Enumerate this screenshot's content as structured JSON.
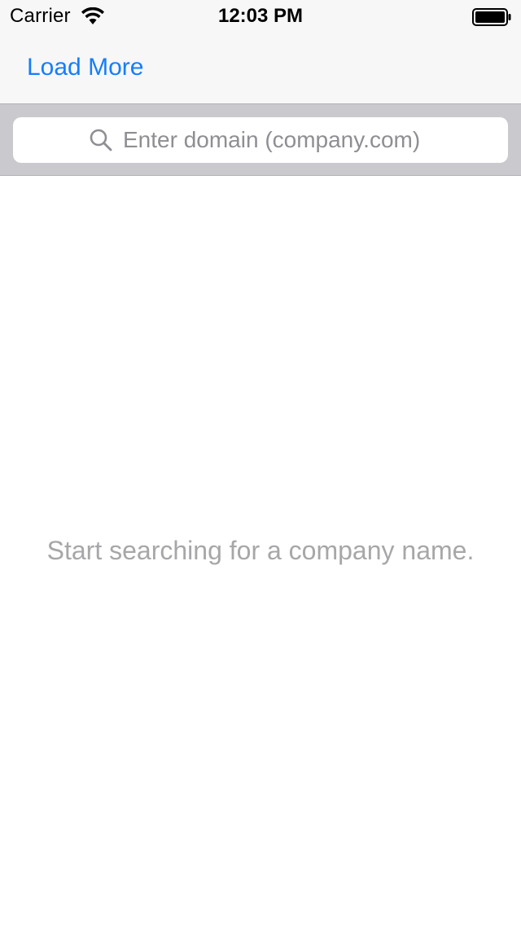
{
  "status_bar": {
    "carrier": "Carrier",
    "time": "12:03 PM",
    "wifi_icon": "wifi-icon",
    "battery_icon": "battery-icon"
  },
  "nav": {
    "load_more_label": "Load More"
  },
  "search": {
    "placeholder": "Enter domain (company.com)",
    "value": "",
    "icon": "search-icon"
  },
  "main": {
    "empty_message": "Start searching for a company name."
  },
  "colors": {
    "accent": "#157efb",
    "search_bar_bg": "#c9c9ce",
    "placeholder": "#8e8e93",
    "empty_text": "#a7a7aa"
  }
}
